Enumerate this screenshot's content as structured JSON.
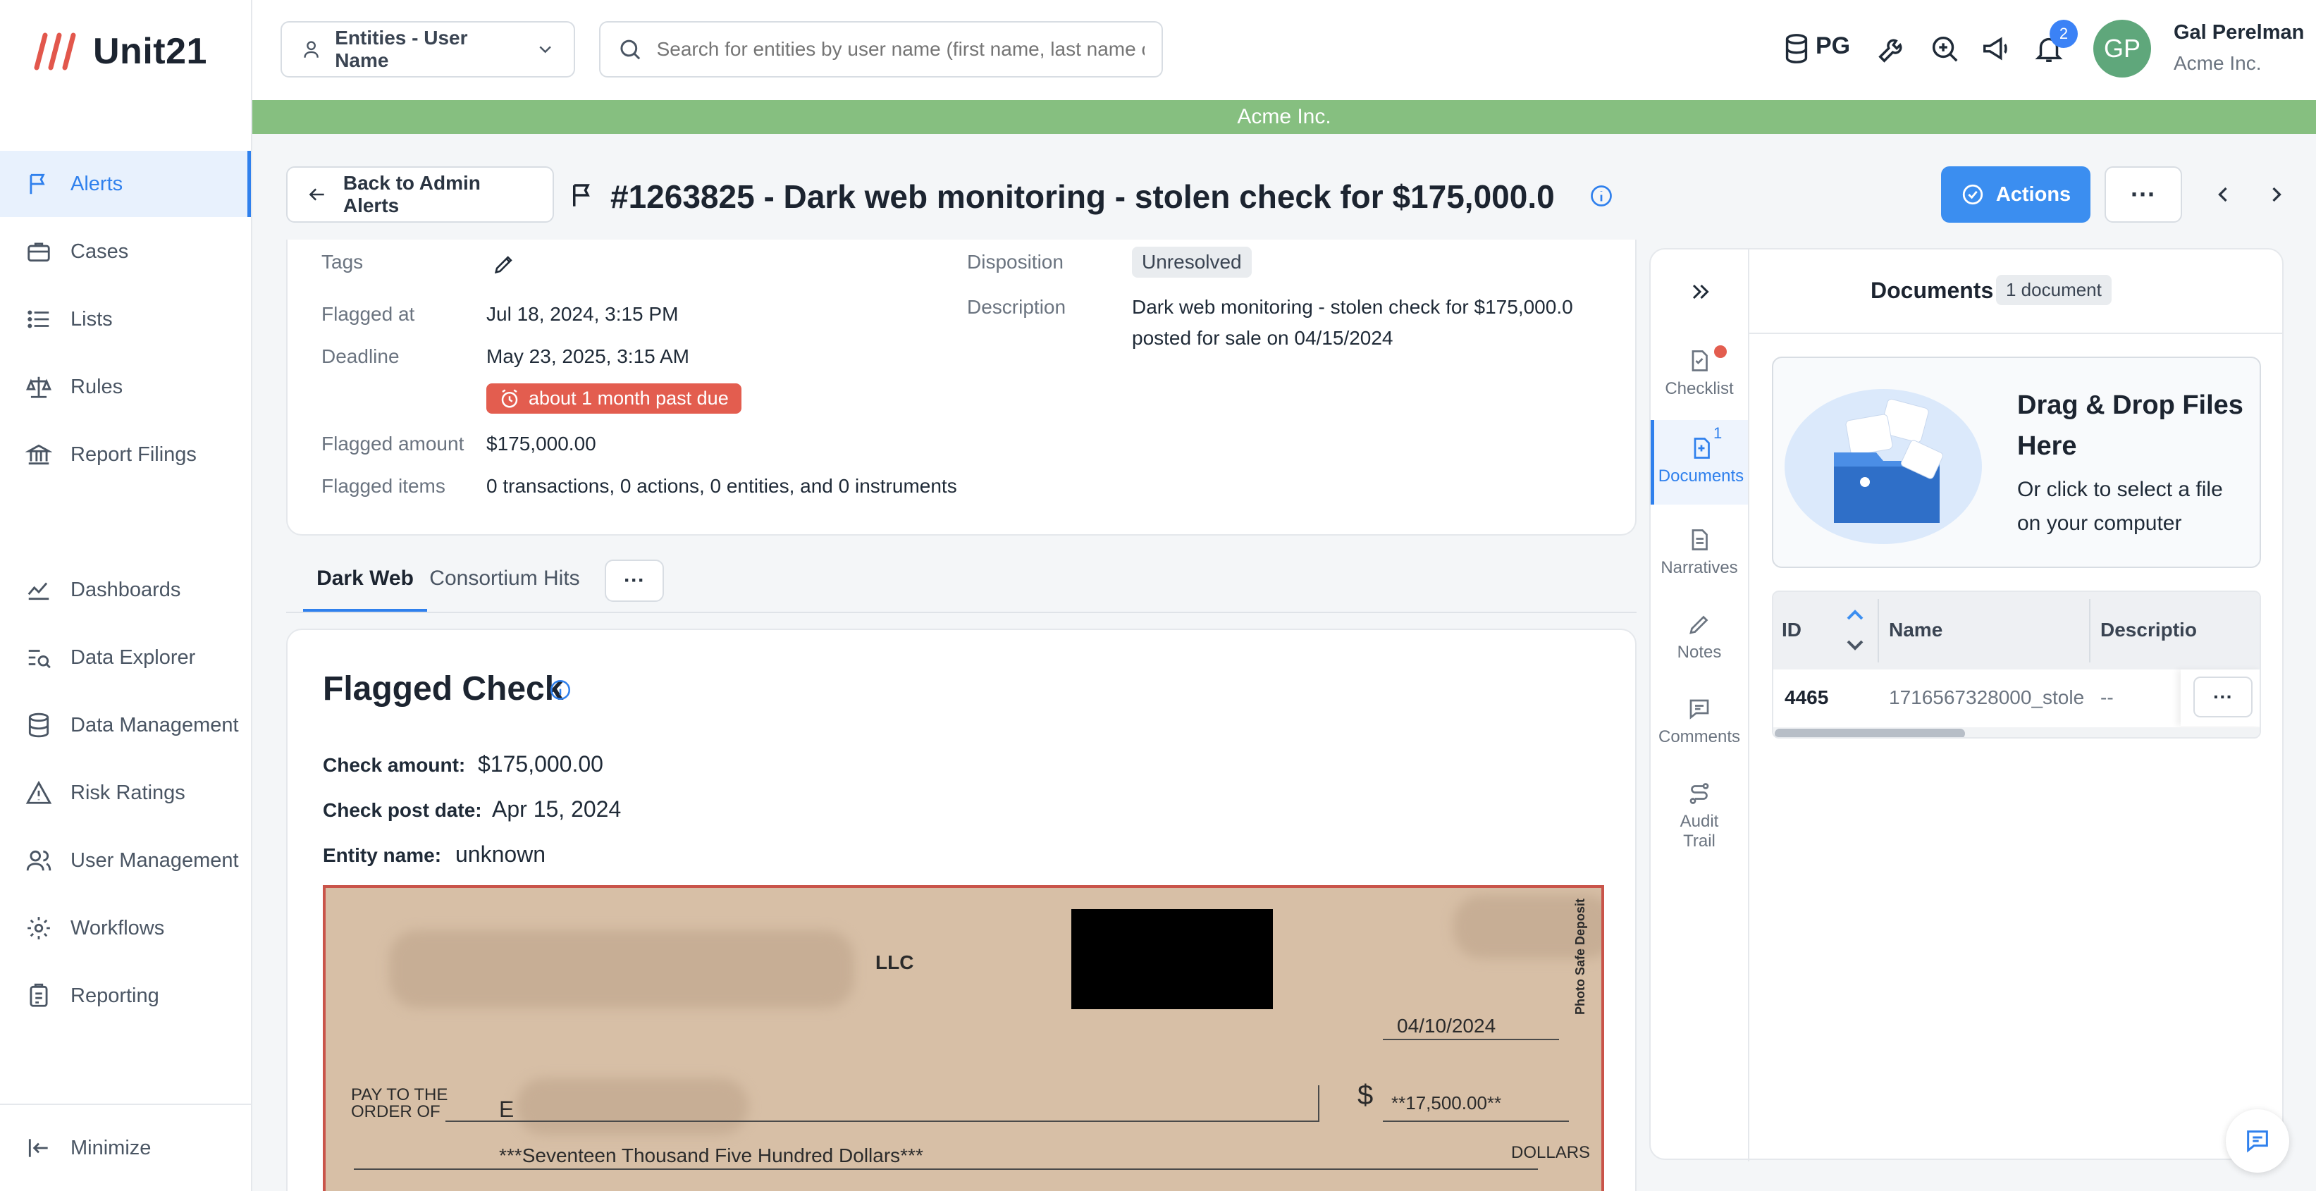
{
  "brand": {
    "name": "Unit21"
  },
  "sidebar": {
    "items": [
      {
        "label": "Alerts",
        "icon": "flag-icon",
        "active": true
      },
      {
        "label": "Cases",
        "icon": "briefcase-icon"
      },
      {
        "label": "Lists",
        "icon": "list-icon"
      },
      {
        "label": "Rules",
        "icon": "scale-icon"
      },
      {
        "label": "Report Filings",
        "icon": "bank-icon"
      },
      {
        "label": "Dashboards",
        "icon": "chart-line-icon"
      },
      {
        "label": "Data Explorer",
        "icon": "data-search-icon"
      },
      {
        "label": "Data Management",
        "icon": "database-icon"
      },
      {
        "label": "Risk Ratings",
        "icon": "warning-icon"
      },
      {
        "label": "User Management",
        "icon": "users-icon"
      },
      {
        "label": "Workflows",
        "icon": "gear-icon"
      },
      {
        "label": "Reporting",
        "icon": "clipboard-icon"
      }
    ],
    "minimize_label": "Minimize"
  },
  "topbar": {
    "entity_select": "Entities - User Name",
    "search_placeholder": "Search for entities by user name (first name, last name o...",
    "pg_label": "PG",
    "notifications_count": "2",
    "avatar_initials": "GP",
    "user_name": "Gal Perelman",
    "user_org": "Acme Inc."
  },
  "orgbar": {
    "label": "Acme Inc."
  },
  "header": {
    "back_label": "Back to Admin Alerts",
    "title": "#1263825 - Dark web monitoring - stolen check for $175,000.0",
    "actions_label": "Actions",
    "more_label": "···"
  },
  "details": {
    "tags_label": "Tags",
    "flagged_at_label": "Flagged at",
    "flagged_at": "Jul 18, 2024, 3:15 PM",
    "deadline_label": "Deadline",
    "deadline": "May 23, 2025, 3:15 AM",
    "past_due": "about 1 month past due",
    "flagged_amount_label": "Flagged amount",
    "flagged_amount": "$175,000.00",
    "flagged_items_label": "Flagged items",
    "flagged_items": "0 transactions, 0 actions, 0 entities, and 0 instruments",
    "disposition_label": "Disposition",
    "disposition": "Unresolved",
    "description_label": "Description",
    "description_line1": "Dark web monitoring - stolen check for $175,000.0",
    "description_line2": "posted for sale on 04/15/2024"
  },
  "tabs": [
    {
      "label": "Dark Web",
      "active": true
    },
    {
      "label": "Consortium Hits"
    }
  ],
  "flagged_check": {
    "title": "Flagged Check",
    "amount_label": "Check amount:",
    "amount": "$175,000.00",
    "post_date_label": "Check post date:",
    "post_date": "Apr 15, 2024",
    "entity_label": "Entity name:",
    "entity": "unknown",
    "image": {
      "llc": "LLC",
      "date": "04/10/2024",
      "pay_to_1": "PAY TO THE",
      "pay_to_2": "ORDER OF",
      "payee_initial": "E",
      "dollar_sign": "$",
      "numeric_amount": "**17,500.00**",
      "written_amount": "***Seventeen Thousand Five Hundred Dollars***",
      "dollars": "DOLLARS",
      "side_text": "Photo Safe Deposit"
    }
  },
  "right_panel": {
    "nav": [
      {
        "label": "Checklist",
        "icon": "checklist-icon"
      },
      {
        "label": "Documents",
        "icon": "document-icon",
        "active": true,
        "count": "1"
      },
      {
        "label": "Narratives",
        "icon": "narrative-icon"
      },
      {
        "label": "Notes",
        "icon": "pencil-icon"
      },
      {
        "label": "Comments",
        "icon": "comment-icon"
      },
      {
        "label": "Audit Trail",
        "icon": "audit-trail-icon"
      }
    ],
    "documents_title": "Documents",
    "documents_count": "1 document",
    "drop_title_1": "Drag & Drop Files",
    "drop_title_2": "Here",
    "drop_sub_1": "Or click to select a file",
    "drop_sub_2": "on your computer",
    "table": {
      "columns": [
        "ID",
        "Name",
        "Descriptio"
      ],
      "rows": [
        {
          "id": "4465",
          "name": "1716567328000_stole",
          "description": "--"
        }
      ]
    }
  },
  "colors": {
    "accent": "#3b8ef0",
    "org_bar": "#86bf80",
    "past_due": "#e35d4f"
  }
}
